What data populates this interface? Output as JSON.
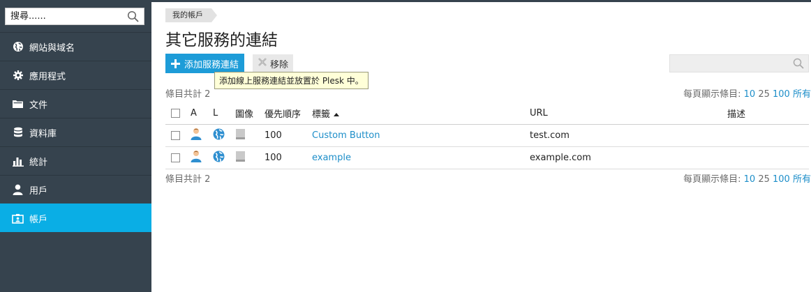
{
  "sidebar": {
    "search_placeholder": "搜尋......",
    "items": [
      {
        "label": "網站與域名",
        "icon": "globe-icon"
      },
      {
        "label": "應用程式",
        "icon": "gear-icon"
      },
      {
        "label": "文件",
        "icon": "folder-icon"
      },
      {
        "label": "資料庫",
        "icon": "database-icon"
      },
      {
        "label": "統計",
        "icon": "bar-chart-icon"
      },
      {
        "label": "用戶",
        "icon": "user-icon"
      },
      {
        "label": "帳戶",
        "icon": "account-card-icon",
        "active": true
      }
    ]
  },
  "breadcrumb": "我的帳戶",
  "title": "其它服務的連結",
  "toolbar": {
    "add_label": "添加服務連結",
    "remove_label": "移除",
    "tooltip": "添加線上服務連結並放置於 Plesk 中。"
  },
  "list": {
    "total_label": "條目共計 2",
    "per_page_label": "每頁顯示條目:",
    "per_page_options": [
      "10",
      "25",
      "100",
      "所有"
    ],
    "per_page_selected": "25",
    "columns": {
      "a": "A",
      "l": "L",
      "image": "圖像",
      "priority": "優先順序",
      "label": "標籤",
      "url": "URL",
      "description": "描述"
    },
    "rows": [
      {
        "priority": "100",
        "label": "Custom Button",
        "url": "test.com",
        "description": ""
      },
      {
        "priority": "100",
        "label": "example",
        "url": "example.com",
        "description": ""
      }
    ]
  },
  "colors": {
    "sidebar_bg": "#36434e",
    "active": "#0aaee5",
    "add_button": "#1d9cd8",
    "link": "#1d8ec9"
  }
}
